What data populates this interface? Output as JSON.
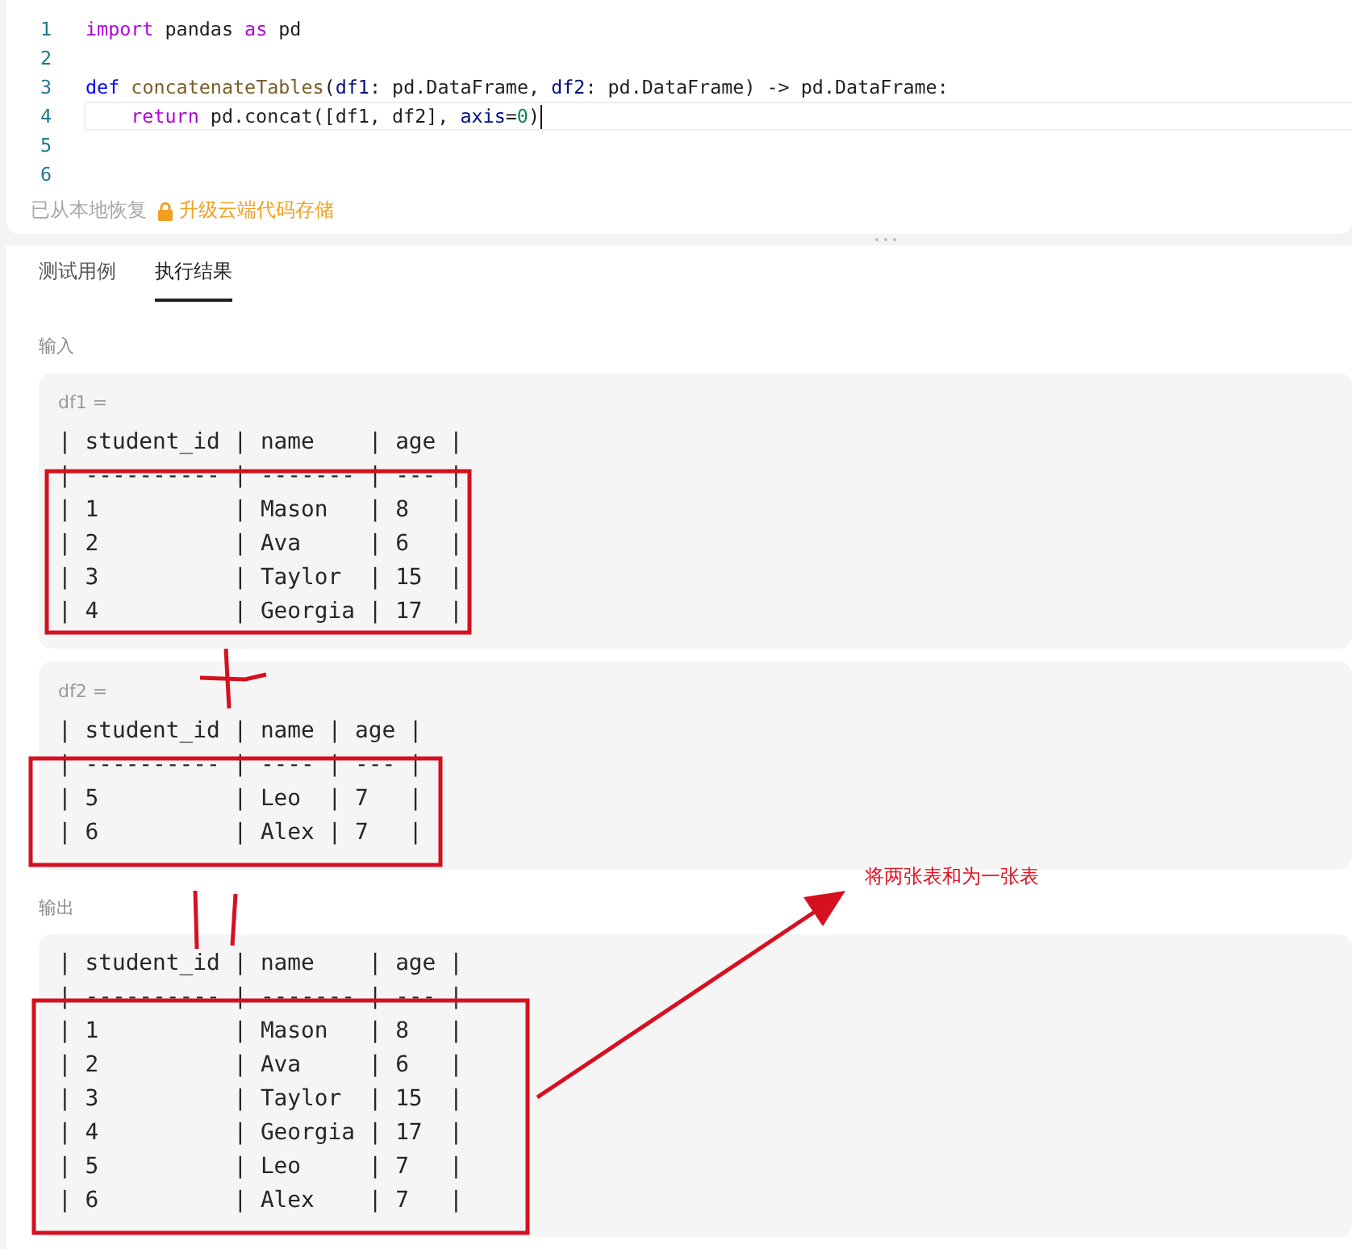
{
  "editor": {
    "lines": [
      {
        "number": "1",
        "current": false,
        "tokens": [
          {
            "text": "import",
            "kind": "keyword"
          },
          {
            "text": " pandas ",
            "kind": "plain"
          },
          {
            "text": "as",
            "kind": "keyword"
          },
          {
            "text": " pd",
            "kind": "plain"
          }
        ]
      },
      {
        "number": "2",
        "current": false
      },
      {
        "number": "3",
        "current": false,
        "tokens": [
          {
            "text": "def",
            "kind": "storage"
          },
          {
            "text": " concatenateTables",
            "kind": "function"
          },
          {
            "text": "(",
            "kind": "plain"
          },
          {
            "text": "df1",
            "kind": "param"
          },
          {
            "text": ": pd.DataFrame, ",
            "kind": "plain"
          },
          {
            "text": "df2",
            "kind": "param"
          },
          {
            "text": ": pd.DataFrame) -> pd.DataFrame:",
            "kind": "plain"
          }
        ]
      },
      {
        "number": "4",
        "current": true,
        "tokens": [
          {
            "text": "    return",
            "kind": "keyword"
          },
          {
            "text": " pd.concat([df1, df2], ",
            "kind": "plain"
          },
          {
            "text": "axis",
            "kind": "param"
          },
          {
            "text": "=",
            "kind": "plain"
          },
          {
            "text": "0",
            "kind": "number"
          },
          {
            "text": ")",
            "kind": "plain"
          }
        ]
      },
      {
        "number": "5",
        "current": false
      },
      {
        "number": "6",
        "current": false
      }
    ],
    "status": "已从本地恢复",
    "upgrade_link": "升级云端代码存储"
  },
  "tabs": [
    {
      "label": "测试用例",
      "selected": false
    },
    {
      "label": "执行结果",
      "selected": true
    }
  ],
  "input": {
    "label": "输入",
    "tables": [
      {
        "name": "df1 =",
        "lines": [
          "| student_id | name    | age |",
          "| ---------- | ------- | --- |",
          "| 1          | Mason   | 8   |",
          "| 2          | Ava     | 6   |",
          "| 3          | Taylor  | 15  |",
          "| 4          | Georgia | 17  |"
        ]
      },
      {
        "name": "df2 =",
        "lines": [
          "| student_id | name | age |",
          "| ---------- | ---- | --- |",
          "| 5          | Leo  | 7   |",
          "| 6          | Alex | 7   |"
        ]
      }
    ]
  },
  "output": {
    "label": "输出",
    "lines": [
      "| student_id | name    | age |",
      "| ---------- | ------- | --- |",
      "| 1          | Mason   | 8   |",
      "| 2          | Ava     | 6   |",
      "| 3          | Taylor  | 15  |",
      "| 4          | Georgia | 17  |",
      "| 5          | Leo     | 7   |",
      "| 6          | Alex    | 7   |"
    ]
  },
  "annotation": {
    "note": "将两张表和为一张表"
  }
}
